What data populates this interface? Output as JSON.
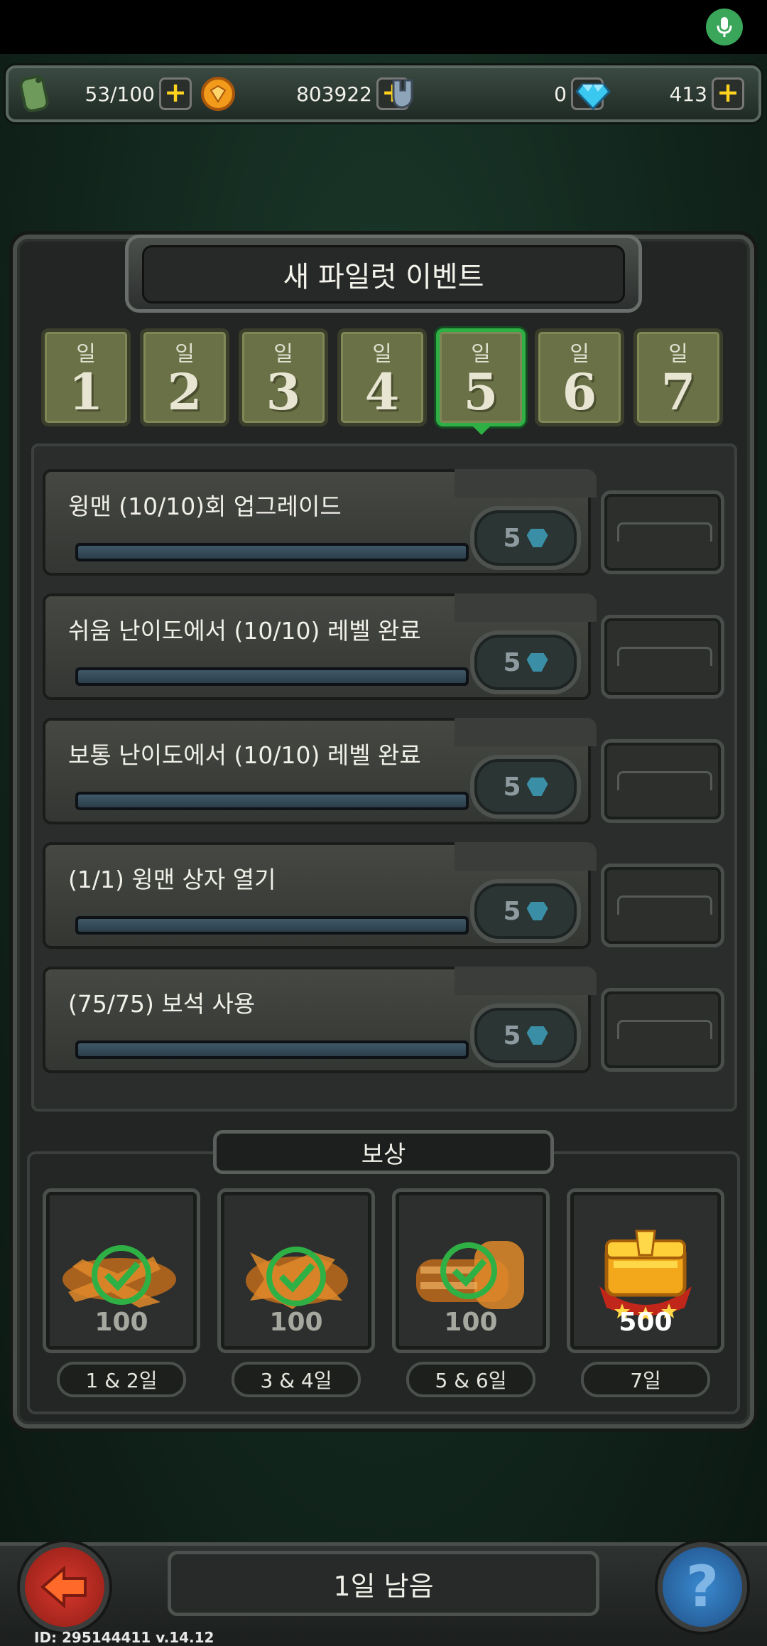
{
  "resources": {
    "fuel": "53/100",
    "coins": "803922",
    "parts": "0",
    "gems": "413"
  },
  "title": "새 파일럿 이벤트",
  "days": [
    {
      "label": "일",
      "num": "1"
    },
    {
      "label": "일",
      "num": "2"
    },
    {
      "label": "일",
      "num": "3"
    },
    {
      "label": "일",
      "num": "4"
    },
    {
      "label": "일",
      "num": "5"
    },
    {
      "label": "일",
      "num": "6"
    },
    {
      "label": "일",
      "num": "7"
    }
  ],
  "active_day": 5,
  "quests": [
    {
      "text": "윙맨 (10/10)회 업그레이드",
      "cost": "5"
    },
    {
      "text": "쉬움 난이도에서 (10/10) 레벨 완료",
      "cost": "5"
    },
    {
      "text": "보통 난이도에서 (10/10) 레벨 완료",
      "cost": "5"
    },
    {
      "text": "(1/1) 윙맨 상자 열기",
      "cost": "5"
    },
    {
      "text": "(75/75) 보석 사용",
      "cost": "5"
    }
  ],
  "rewards_title": "보상",
  "rewards": [
    {
      "amount": "100",
      "day": "1 & 2일",
      "claimed": true
    },
    {
      "amount": "100",
      "day": "3 & 4일",
      "claimed": true
    },
    {
      "amount": "100",
      "day": "5 & 6일",
      "claimed": true
    },
    {
      "amount": "500",
      "day": "7일",
      "claimed": false
    }
  ],
  "remaining": "1일 남음",
  "build_id": "ID: 295144411  v.14.12",
  "colors": {
    "accent_green": "#2fb045",
    "gold": "#ffd21e",
    "gem_blue": "#3ac8f0"
  }
}
